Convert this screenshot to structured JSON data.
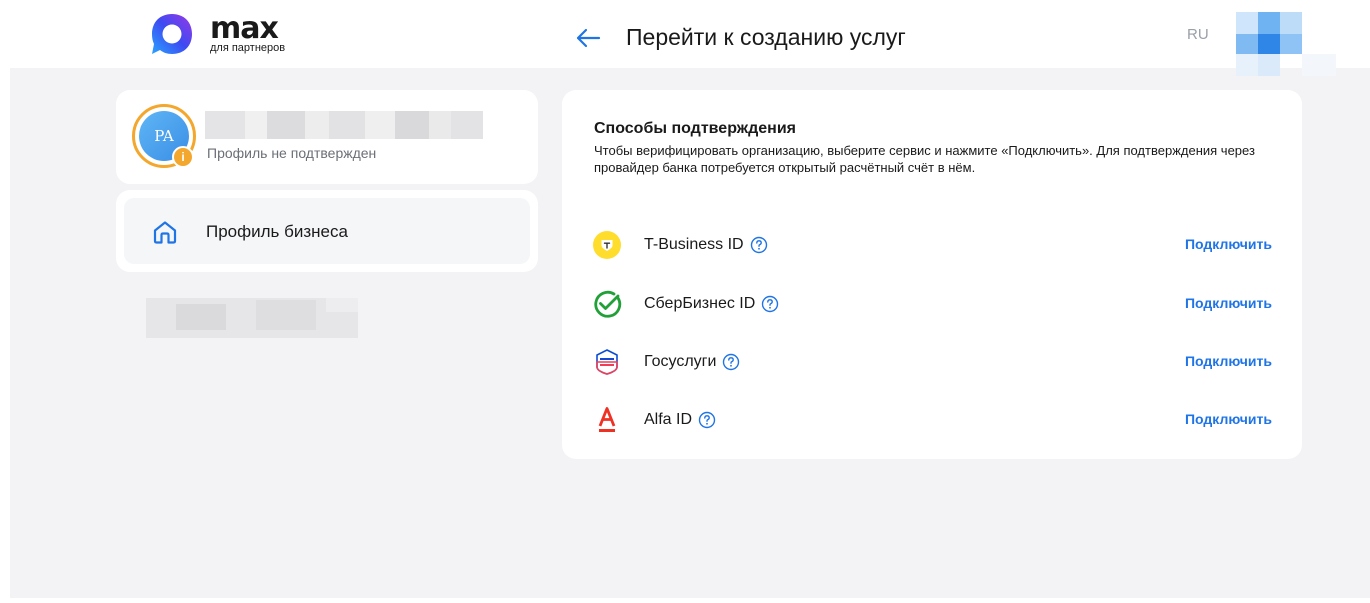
{
  "header": {
    "logo_name": "max",
    "logo_subtitle": "для партнеров",
    "page_title": "Перейти к созданию услуг",
    "language": "RU"
  },
  "sidebar": {
    "avatar_initials": "PA",
    "profile_status": "Профиль не подтвержден",
    "menu_items": [
      {
        "label": "Профиль бизнеса",
        "icon": "home-icon"
      }
    ]
  },
  "verification": {
    "title": "Способы подтверждения",
    "description": "Чтобы верифицировать организацию, выберите сервис и нажмите «Подключить». Для подтверждения через провайдер банка потребуется открытый расчётный счёт в нём.",
    "providers": [
      {
        "name": "T-Business ID",
        "icon": "t-business-logo",
        "action": "Подключить"
      },
      {
        "name": "СберБизнес ID",
        "icon": "sberbusiness-logo",
        "action": "Подключить"
      },
      {
        "name": "Госуслуги",
        "icon": "gosuslugi-logo",
        "action": "Подключить"
      },
      {
        "name": "Alfa ID",
        "icon": "alfa-logo",
        "action": "Подключить"
      }
    ]
  },
  "colors": {
    "accent": "#1f74e6",
    "warning": "#f3a72c",
    "background": "#f3f3f5"
  }
}
